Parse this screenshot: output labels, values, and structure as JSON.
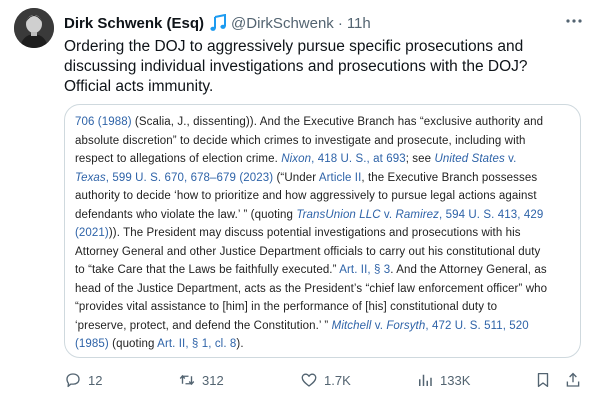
{
  "post": {
    "author_name": "Dirk Schwenk (Esq)",
    "handle": "@DirkSchwenk",
    "separator": "·",
    "time": "11h",
    "text_lines": [
      "Ordering the DOJ to aggressively pursue specific prosecutions and",
      "discussing individual investigations and prosecutions with the DOJ?",
      "Official acts immunity."
    ]
  },
  "excerpt": {
    "lines": [
      [
        {
          "t": "706 (1988)",
          "s": "link"
        },
        {
          "t": " (Scalia, J., dissenting)). And the Executive Branch has “exclusive authority and",
          "s": "plain"
        }
      ],
      [
        {
          "t": "absolute discretion” to decide which crimes to investigate and prosecute, including with",
          "s": "plain"
        }
      ],
      [
        {
          "t": "respect to allegations of election crime. ",
          "s": "plain"
        },
        {
          "t": "Nixon",
          "s": "link-italic"
        },
        {
          "t": ", 418 U. S., at 693",
          "s": "link"
        },
        {
          "t": "; see ",
          "s": "plain"
        },
        {
          "t": "United States",
          "s": "link-italic"
        },
        {
          "t": " v.",
          "s": "link"
        }
      ],
      [
        {
          "t": "Texas",
          "s": "link-italic"
        },
        {
          "t": ", 599 U. S. 670, 678–679 (2023)",
          "s": "link"
        },
        {
          "t": " (“Under ",
          "s": "plain"
        },
        {
          "t": "Article II",
          "s": "link"
        },
        {
          "t": ", the Executive Branch possesses",
          "s": "plain"
        }
      ],
      [
        {
          "t": "authority to decide ‘how to prioritize and how aggressively to pursue legal actions against",
          "s": "plain"
        }
      ],
      [
        {
          "t": "defendants who violate the law.’ ” (quoting ",
          "s": "plain"
        },
        {
          "t": "TransUnion LLC",
          "s": "link-italic"
        },
        {
          "t": " v. ",
          "s": "link"
        },
        {
          "t": "Ramirez",
          "s": "link-italic"
        },
        {
          "t": ", 594 U. S. 413, 429",
          "s": "link"
        }
      ],
      [
        {
          "t": "(2021)",
          "s": "link"
        },
        {
          "t": ")). The President may discuss potential investigations and prosecutions with his",
          "s": "plain"
        }
      ],
      [
        {
          "t": "Attorney General and other Justice Department officials to carry out his constitutional duty",
          "s": "plain"
        }
      ],
      [
        {
          "t": "to “take Care that the Laws be faithfully executed.” ",
          "s": "plain"
        },
        {
          "t": "Art. II, § 3",
          "s": "link"
        },
        {
          "t": ". And the Attorney General, as",
          "s": "plain"
        }
      ],
      [
        {
          "t": "head of the Justice Department, acts as the President’s “chief law enforcement officer” who",
          "s": "plain"
        }
      ],
      [
        {
          "t": "“provides vital assistance to [him] in the performance of [his] constitutional duty to",
          "s": "plain"
        }
      ],
      [
        {
          "t": "‘preserve, protect, and defend the Constitution.’ ” ",
          "s": "plain"
        },
        {
          "t": "Mitchell",
          "s": "link-italic"
        },
        {
          "t": " v. ",
          "s": "link"
        },
        {
          "t": "Forsyth",
          "s": "link-italic"
        },
        {
          "t": ", 472 U. S. 511, 520",
          "s": "link"
        }
      ],
      [
        {
          "t": "(1985)",
          "s": "link"
        },
        {
          "t": " (quoting ",
          "s": "plain"
        },
        {
          "t": "Art. II, § 1, cl. 8",
          "s": "link"
        },
        {
          "t": ").",
          "s": "plain"
        }
      ]
    ]
  },
  "actions": {
    "replies": "12",
    "reposts": "312",
    "likes": "1.7K",
    "views": "133K"
  },
  "icons": {
    "verified_badge": "music-note-icon",
    "more": "more-dots-icon",
    "reply": "reply-icon",
    "repost": "repost-icon",
    "like": "heart-icon",
    "views": "views-bar-icon",
    "bookmark": "bookmark-icon",
    "share": "share-icon"
  },
  "colors": {
    "link": "#2e63a8",
    "secondary_text": "#536471",
    "badge": "#1d9bf0",
    "border": "#cfd9de"
  }
}
